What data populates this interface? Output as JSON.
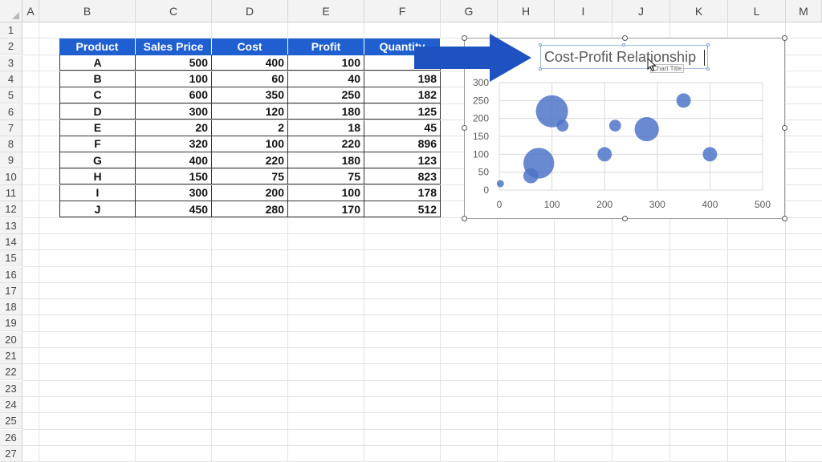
{
  "sheet": {
    "columns": [
      "A",
      "B",
      "C",
      "D",
      "E",
      "F",
      "G",
      "H",
      "I",
      "J",
      "K",
      "L",
      "M"
    ],
    "rows": [
      "1",
      "2",
      "3",
      "4",
      "5",
      "6",
      "7",
      "8",
      "9",
      "10",
      "11",
      "12",
      "13",
      "14",
      "15",
      "16",
      "17",
      "18",
      "19",
      "20",
      "21",
      "22",
      "23",
      "24",
      "25",
      "26",
      "27"
    ]
  },
  "table": {
    "headers": [
      "Product",
      "Sales Price",
      "Cost",
      "Profit",
      "Quantity"
    ],
    "rows": [
      [
        "A",
        "500",
        "400",
        "100",
        ""
      ],
      [
        "B",
        "100",
        "60",
        "40",
        "198"
      ],
      [
        "C",
        "600",
        "350",
        "250",
        "182"
      ],
      [
        "D",
        "300",
        "120",
        "180",
        "125"
      ],
      [
        "E",
        "20",
        "2",
        "18",
        "45"
      ],
      [
        "F",
        "320",
        "100",
        "220",
        "896"
      ],
      [
        "G",
        "400",
        "220",
        "180",
        "123"
      ],
      [
        "H",
        "150",
        "75",
        "75",
        "823"
      ],
      [
        "I",
        "300",
        "200",
        "100",
        "178"
      ],
      [
        "J",
        "450",
        "280",
        "170",
        "512"
      ]
    ]
  },
  "chart": {
    "title": "Cost-Profit Relationship",
    "tooltip": "Chart Title",
    "bubble_color": "#4f74c8",
    "arrow_color": "#1e52c0"
  },
  "chart_data": {
    "type": "scatter",
    "title": "Cost-Profit Relationship",
    "xlabel": "",
    "ylabel": "",
    "xlim": [
      0,
      500
    ],
    "ylim": [
      0,
      300
    ],
    "x_ticks": [
      "0",
      "100",
      "200",
      "300",
      "400",
      "500"
    ],
    "y_ticks": [
      "0",
      "50",
      "100",
      "150",
      "200",
      "250",
      "300"
    ],
    "grid": true,
    "points": [
      {
        "x": 400,
        "y": 100,
        "size": 180
      },
      {
        "x": 60,
        "y": 40,
        "size": 198
      },
      {
        "x": 350,
        "y": 250,
        "size": 182
      },
      {
        "x": 120,
        "y": 180,
        "size": 125
      },
      {
        "x": 2,
        "y": 18,
        "size": 45
      },
      {
        "x": 100,
        "y": 220,
        "size": 896
      },
      {
        "x": 220,
        "y": 180,
        "size": 123
      },
      {
        "x": 75,
        "y": 75,
        "size": 823
      },
      {
        "x": 200,
        "y": 100,
        "size": 178
      },
      {
        "x": 280,
        "y": 170,
        "size": 512
      }
    ]
  }
}
